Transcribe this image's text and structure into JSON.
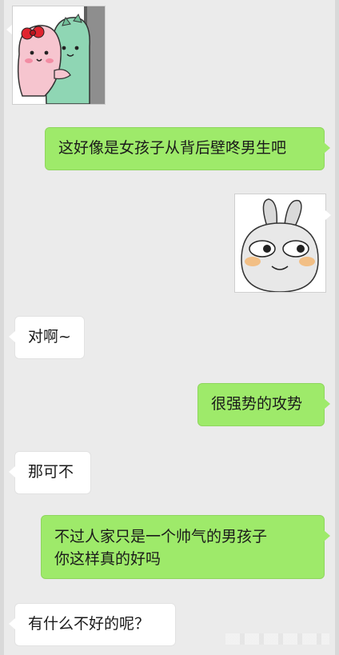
{
  "messages": [
    {
      "side": "recv",
      "type": "sticker",
      "sticker": "pink-dinosaur-hugging-green-dinosaur-sticker"
    },
    {
      "side": "sent",
      "type": "text",
      "text": "这好像是女孩子从背后壁咚男生吧"
    },
    {
      "side": "sent",
      "type": "sticker",
      "sticker": "grinning-rabbit-sticker"
    },
    {
      "side": "recv",
      "type": "text",
      "text": "对啊~"
    },
    {
      "side": "sent",
      "type": "text",
      "text": "很强势的攻势"
    },
    {
      "side": "recv",
      "type": "text",
      "text": "那可不"
    },
    {
      "side": "sent",
      "type": "text",
      "lines": [
        "不过人家只是一个帅气的男孩子",
        "你这样真的好吗"
      ]
    },
    {
      "side": "recv",
      "type": "text",
      "text": "有什么不好的呢？"
    }
  ],
  "colors": {
    "background": "#ebebeb",
    "sent_bubble": "#9eea6a",
    "received_bubble": "#ffffff"
  }
}
